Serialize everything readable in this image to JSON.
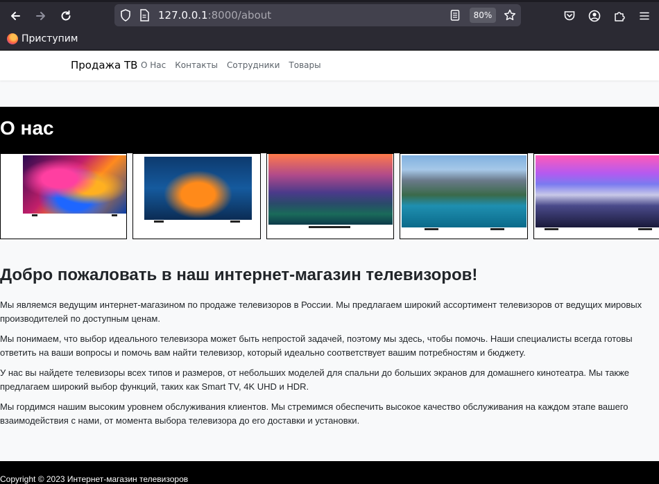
{
  "browser": {
    "url_host": "127.0.0.1",
    "url_path": ":8000/about",
    "zoom": "80%",
    "bookmark": "Приступим"
  },
  "site": {
    "brand": "Продажа ТВ",
    "nav": [
      "О Нас",
      "Контакты",
      "Сотрудники",
      "Товары"
    ]
  },
  "hero": {
    "title": "О нас"
  },
  "main": {
    "heading": "Добро пожаловать в наш интернет-магазин телевизоров!",
    "paragraphs": [
      "Мы являемся ведущим интернет-магазином по продаже телевизоров в России. Мы предлагаем широкий ассортимент телевизоров от ведущих мировых производителей по доступным ценам.",
      "Мы понимаем, что выбор идеального телевизора может быть непростой задачей, поэтому мы здесь, чтобы помочь. Наши специалисты всегда готовы ответить на ваши вопросы и помочь вам найти телевизор, который идеально соответствует вашим потребностям и бюджету.",
      "У нас вы найдете телевизоры всех типов и размеров, от небольших моделей для спальни до больших экранов для домашнего кинотеатра. Мы также предлагаем широкий выбор функций, таких как Smart TV, 4K UHD и HDR.",
      "Мы гордимся нашим высоким уровнем обслуживания клиентов. Мы стремимся обеспечить высокое качество обслуживания на каждом этапе вашего взаимодействия с нами, от момента выбора телевизора до его доставки и установки."
    ]
  },
  "footer": {
    "text": "Copyright © 2023 Интернет-магазин телевизоров"
  },
  "icons": [
    "back-icon",
    "forward-icon",
    "reload-icon",
    "shield-icon",
    "page-icon",
    "reader-icon",
    "star-icon",
    "pocket-icon",
    "account-icon",
    "extensions-icon",
    "menu-icon",
    "firefox-icon"
  ]
}
